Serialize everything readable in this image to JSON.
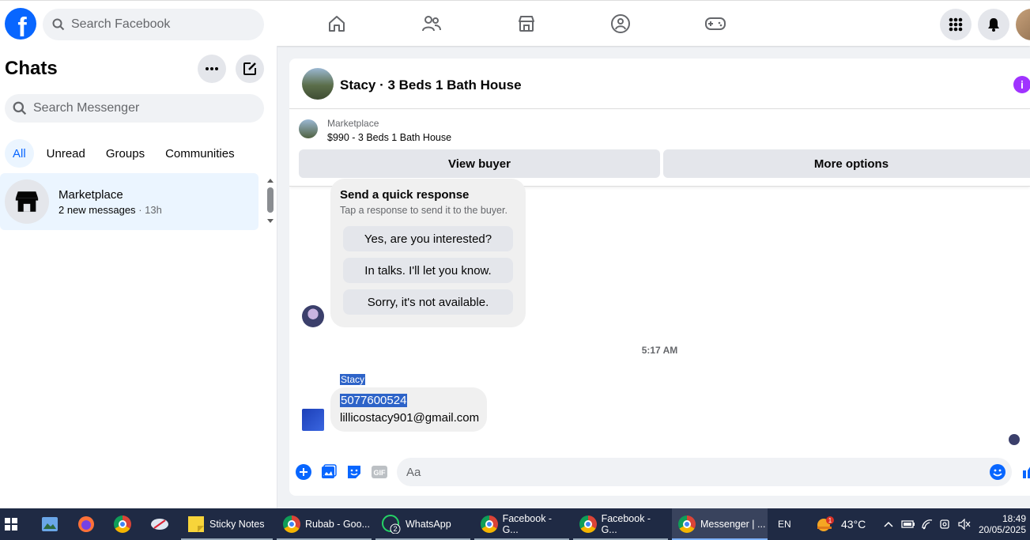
{
  "topbar": {
    "logo": "f",
    "search_placeholder": "Search Facebook",
    "nav_icons": [
      "home-icon",
      "friends-icon",
      "marketplace-icon",
      "groups-icon",
      "gaming-icon"
    ],
    "right_icons": [
      "menu-grid-icon",
      "notifications-icon",
      "profile-avatar"
    ]
  },
  "sidebar": {
    "title": "Chats",
    "search_placeholder": "Search Messenger",
    "filters": [
      {
        "label": "All",
        "active": true
      },
      {
        "label": "Unread",
        "active": false
      },
      {
        "label": "Groups",
        "active": false
      },
      {
        "label": "Communities",
        "active": false
      }
    ],
    "chat": {
      "name": "Marketplace",
      "preview": "2 new messages",
      "time": "· 13h"
    }
  },
  "conversation": {
    "title": "Stacy · 3 Beds 1 Bath House",
    "marketplace_label": "Marketplace",
    "listing": "$990 - 3 Beds 1 Bath House",
    "view_buyer": "View buyer",
    "more_options": "More options",
    "quick_response": {
      "title": "Send a quick response",
      "subtitle": "Tap a response to send it to the buyer.",
      "options": [
        "Yes, are you interested?",
        "In talks. I'll let you know.",
        "Sorry, it's not available."
      ]
    },
    "timestamp": "5:17 AM",
    "sender": "Stacy",
    "message_line1": "5077600524",
    "message_line2": "lillicostacy901@gmail.com",
    "composer_placeholder": "Aa"
  },
  "taskbar": {
    "apps": [
      {
        "label": "Sticky Notes"
      },
      {
        "label": "Rubab - Goo..."
      },
      {
        "label": "WhatsApp",
        "badge": "2"
      },
      {
        "label": "Facebook - G..."
      },
      {
        "label": "Facebook - G..."
      },
      {
        "label": "Messenger | ..."
      }
    ],
    "lang": "EN",
    "weather_badge": "1",
    "temperature": "43°C",
    "time": "18:49",
    "date": "20/05/2025"
  },
  "colors": {
    "brand": "#0866ff",
    "highlight": "#2d63c8",
    "info": "#a033ff",
    "taskbar": "#1f2a44"
  }
}
